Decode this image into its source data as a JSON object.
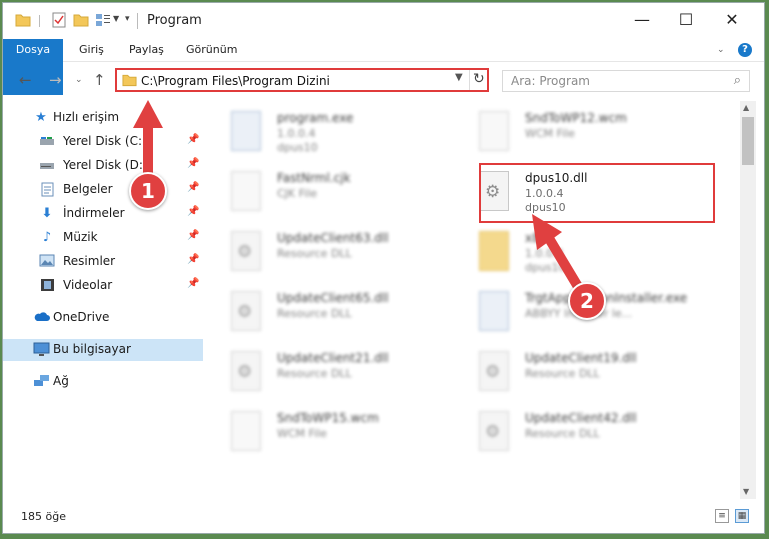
{
  "window": {
    "title": "Program",
    "controls": {
      "minimize": "—",
      "maximize": "☐",
      "close": "✕"
    }
  },
  "ribbon": {
    "tabs": [
      "Dosya",
      "Giriş",
      "Paylaş",
      "Görünüm"
    ],
    "help": "?"
  },
  "nav": {
    "address": "C:\\Program Files\\Program Dizini",
    "search_placeholder": "Ara: Program"
  },
  "sidebar": {
    "items": [
      {
        "label": "Hızlı erişim",
        "icon": "star-icon",
        "pinned": false
      },
      {
        "label": "Yerel Disk (C:)",
        "icon": "drive-icon",
        "pinned": true
      },
      {
        "label": "Yerel Disk (D:)",
        "icon": "drive-icon",
        "pinned": true
      },
      {
        "label": "Belgeler",
        "icon": "documents-icon",
        "pinned": true
      },
      {
        "label": "İndirmeler",
        "icon": "download-icon",
        "pinned": true
      },
      {
        "label": "Müzik",
        "icon": "music-icon",
        "pinned": true
      },
      {
        "label": "Resimler",
        "icon": "pictures-icon",
        "pinned": true
      },
      {
        "label": "Videolar",
        "icon": "video-icon",
        "pinned": true
      },
      {
        "label": "OneDrive",
        "icon": "cloud-icon",
        "pinned": false
      },
      {
        "label": "Bu bilgisayar",
        "icon": "computer-icon",
        "pinned": false,
        "selected": true
      },
      {
        "label": "Ağ",
        "icon": "network-icon",
        "pinned": false
      }
    ]
  },
  "files": [
    {
      "name": "program.exe",
      "line1": "1.0.0.4",
      "line2": "dpus10"
    },
    {
      "name": "SndToWP12.wcm",
      "line1": "WCM File",
      "line2": ""
    },
    {
      "name": "FastNrml.cjk",
      "line1": "CJK File",
      "line2": ""
    },
    {
      "name": "dpus10.dll",
      "line1": "1.0.0.4",
      "line2": "dpus10"
    },
    {
      "name": "UpdateClient63.dll",
      "line1": "Resource DLL",
      "line2": ""
    },
    {
      "name": "x86",
      "line1": "1.0.0.4",
      "line2": "dpus10"
    },
    {
      "name": "UpdateClient65.dll",
      "line1": "Resource DLL",
      "line2": ""
    },
    {
      "name": "TrgtApplicationInstaller.exe",
      "line1": "ABBYY Installer le...",
      "line2": ""
    },
    {
      "name": "UpdateClient21.dll",
      "line1": "Resource DLL",
      "line2": ""
    },
    {
      "name": "UpdateClient19.dll",
      "line1": "Resource DLL",
      "line2": ""
    },
    {
      "name": "SndToWP15.wcm",
      "line1": "WCM File",
      "line2": ""
    },
    {
      "name": "UpdateClient42.dll",
      "line1": "Resource DLL",
      "line2": ""
    }
  ],
  "callouts": [
    "1",
    "2"
  ],
  "status": {
    "count": "185 öğe"
  },
  "colors": {
    "accent": "#1979ca",
    "highlight": "#e03b3b",
    "selected_bg": "#cce4f7"
  }
}
